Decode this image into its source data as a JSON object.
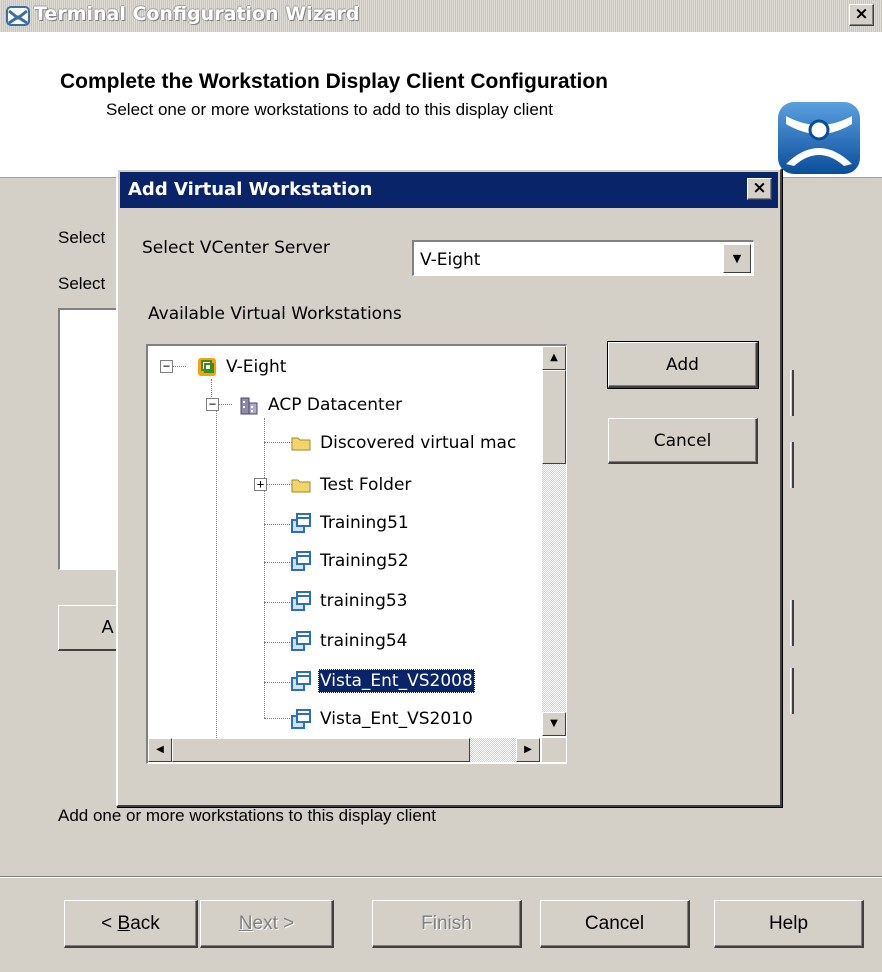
{
  "wizard": {
    "title": "Terminal Configuration Wizard",
    "close_label": "×",
    "header_title": "Complete the Workstation Display Client Configuration",
    "header_subtitle": "Select one or more workstations to add to this display client",
    "behind_label_1": "Select",
    "behind_label_2": "Select",
    "behind_button": "A",
    "footer_hint": "Add one or more workstations to this display client",
    "buttons": {
      "back": {
        "prefix": "< ",
        "accel": "B",
        "rest": "ack"
      },
      "next": {
        "accel": "N",
        "rest": "ext >"
      },
      "finish": "Finish",
      "cancel": "Cancel",
      "help": "Help"
    }
  },
  "dialog": {
    "title": "Add Virtual Workstation",
    "close_label": "×",
    "vcenter_label": "Select VCenter Server",
    "vcenter_value": "V-Eight",
    "available_label": "Available Virtual Workstations",
    "add_button": "Add",
    "cancel_button": "Cancel",
    "tree": {
      "root": "V-Eight",
      "datacenter": "ACP Datacenter",
      "items": [
        {
          "label": "Discovered virtual mac",
          "icon": "folder-icon"
        },
        {
          "label": "Test Folder",
          "icon": "folder-icon"
        },
        {
          "label": "Training51",
          "icon": "virtual-machine-icon"
        },
        {
          "label": "Training52",
          "icon": "virtual-machine-icon"
        },
        {
          "label": "training53",
          "icon": "virtual-machine-icon"
        },
        {
          "label": "training54",
          "icon": "virtual-machine-icon"
        },
        {
          "label": "Vista_Ent_VS2008",
          "icon": "virtual-machine-icon",
          "selected": true
        },
        {
          "label": "Vista_Ent_VS2010",
          "icon": "virtual-machine-icon"
        }
      ]
    }
  },
  "colors": {
    "dialog_title_bg": "#0a246a",
    "face": "#d4d0c8",
    "selection": "#0a246a"
  }
}
